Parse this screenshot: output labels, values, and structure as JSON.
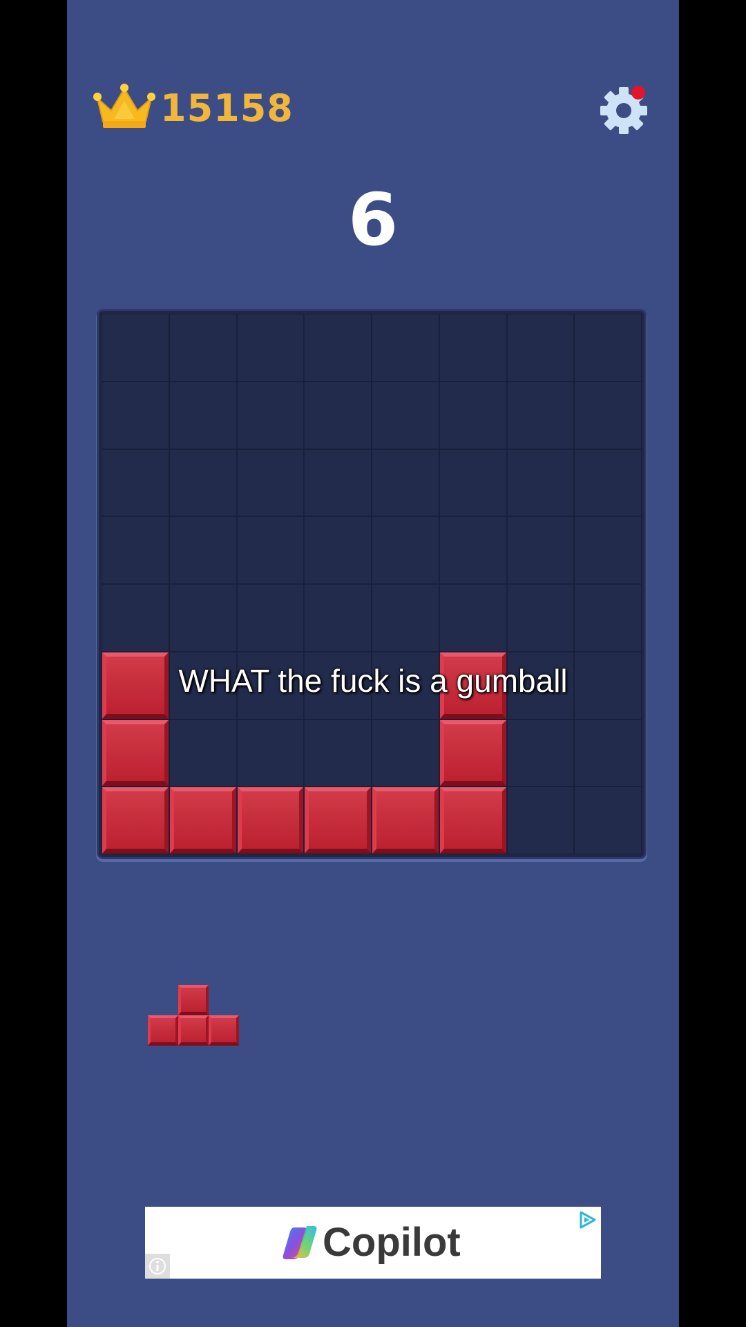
{
  "header": {
    "best_score": "15158",
    "settings_notification": true
  },
  "level": {
    "number": "6"
  },
  "board": {
    "rows": 8,
    "cols": 8,
    "block_color": "#cc2434",
    "filled_cells": [
      [
        5,
        0
      ],
      [
        5,
        5
      ],
      [
        6,
        0
      ],
      [
        6,
        5
      ],
      [
        7,
        0
      ],
      [
        7,
        1
      ],
      [
        7,
        2
      ],
      [
        7,
        3
      ],
      [
        7,
        4
      ],
      [
        7,
        5
      ]
    ]
  },
  "caption": {
    "text": "WHAT the fuck is a gumball"
  },
  "tray": {
    "piece": {
      "shape": "T",
      "cells": [
        [
          0,
          1
        ],
        [
          1,
          0
        ],
        [
          1,
          1
        ],
        [
          1,
          2
        ]
      ],
      "color": "#cc2434"
    }
  },
  "ad": {
    "brand": "Copilot"
  },
  "colors": {
    "background": "#3c4d86",
    "board": "#1f2745",
    "score": "#f2b63a",
    "settings": "#cfe3f7",
    "notification": "#e3142a"
  },
  "icons": [
    "crown-icon",
    "gear-icon",
    "copilot-logo-icon",
    "ad-choices-icon",
    "info-icon"
  ]
}
